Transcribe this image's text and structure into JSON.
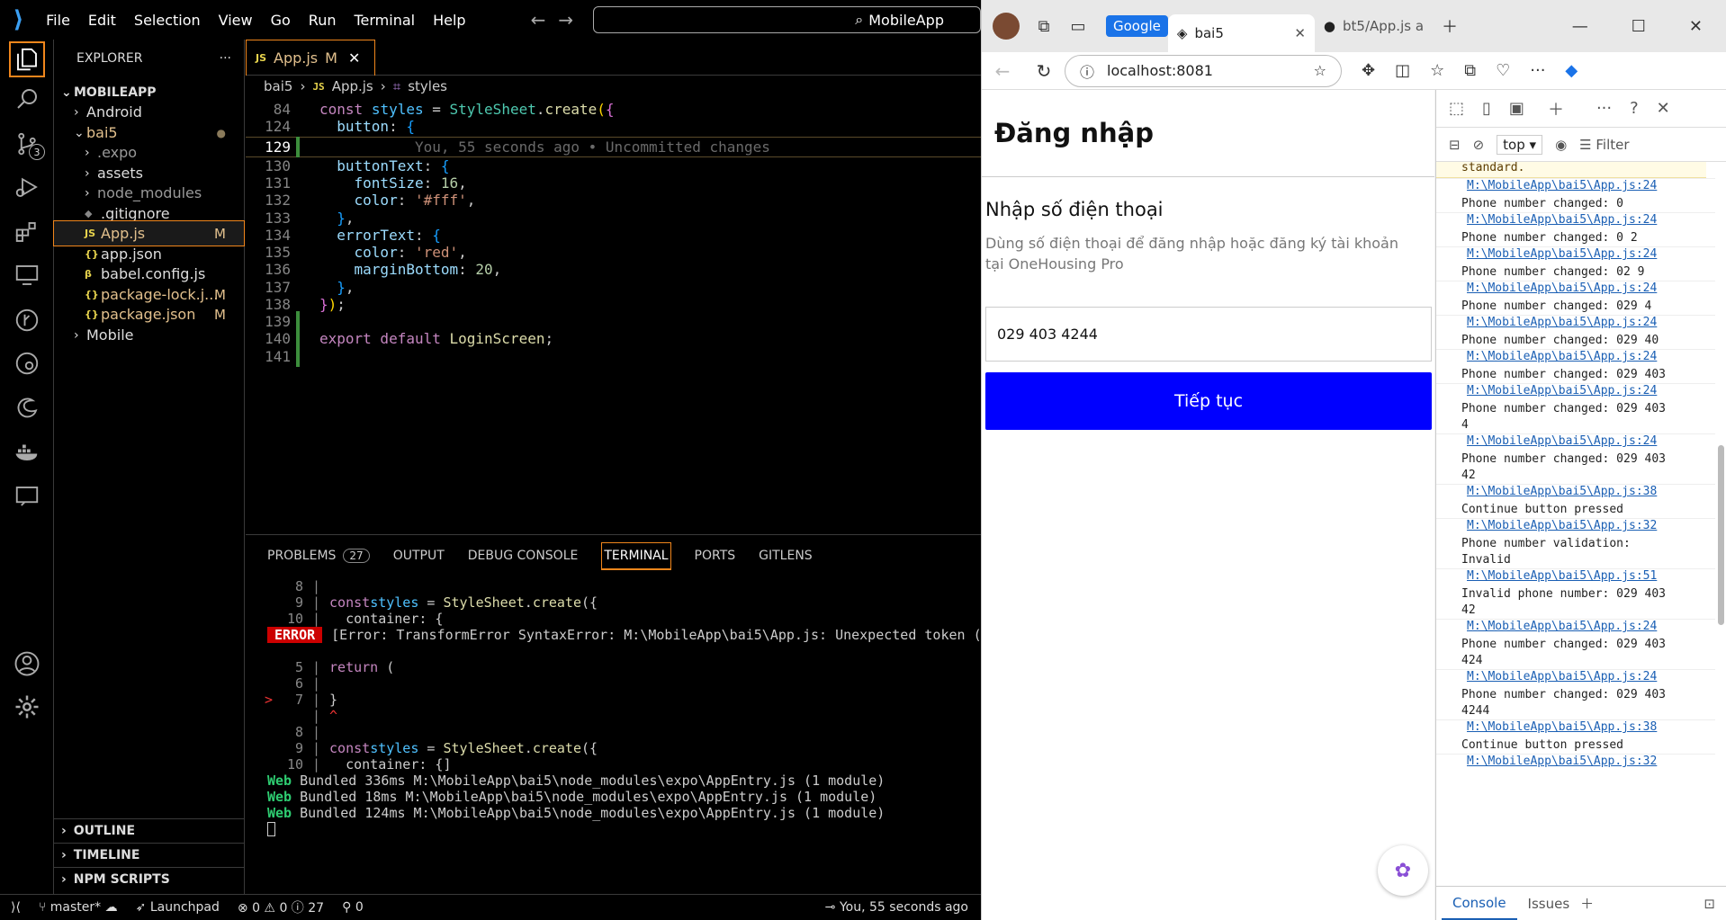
{
  "vscode": {
    "menu": [
      "File",
      "Edit",
      "Selection",
      "View",
      "Go",
      "Run",
      "Terminal",
      "Help"
    ],
    "command_center": "MobileApp",
    "explorer": {
      "title": "EXPLORER",
      "root": "MOBILEAPP",
      "items": [
        {
          "label": "Android",
          "type": "folder"
        },
        {
          "label": "bai5",
          "type": "folder-open"
        },
        {
          "label": ".expo",
          "type": "folder"
        },
        {
          "label": "assets",
          "type": "folder"
        },
        {
          "label": "node_modules",
          "type": "folder"
        },
        {
          "label": ".gitignore",
          "type": "file"
        },
        {
          "label": "App.js",
          "type": "js",
          "mod": "M"
        },
        {
          "label": "app.json",
          "type": "json"
        },
        {
          "label": "babel.config.js",
          "type": "babel"
        },
        {
          "label": "package-lock.j...",
          "type": "json",
          "mod": "M"
        },
        {
          "label": "package.json",
          "type": "json",
          "mod": "M"
        },
        {
          "label": "Mobile",
          "type": "folder"
        }
      ],
      "sections": [
        "OUTLINE",
        "TIMELINE",
        "NPM SCRIPTS"
      ]
    },
    "tab": {
      "label": "App.js",
      "mod": "M"
    },
    "breadcrumb": [
      "bai5",
      "App.js",
      "styles"
    ],
    "code": {
      "l84": "84",
      "l124": "124",
      "l129": "129",
      "l130": "130",
      "l131": "131",
      "l132": "132",
      "l133": "133",
      "l134": "134",
      "l135": "135",
      "l136": "136",
      "l137": "137",
      "l138": "138",
      "l139": "139",
      "l140": "140",
      "l141": "141",
      "blame": "You, 55 seconds ago • Uncommitted changes",
      "export_line": "export default LoginScreen;"
    },
    "panel": {
      "tabs": [
        "PROBLEMS",
        "OUTPUT",
        "DEBUG CONSOLE",
        "TERMINAL",
        "PORTS",
        "GITLENS"
      ],
      "problems_count": "27",
      "error_label": "ERROR",
      "error_text": "[Error: TransformError SyntaxError: M:\\MobileApp\\bai5\\App.js: Unexpected token (",
      "bundles": [
        {
          "tag": "Web",
          "text": " Bundled 336ms M:\\MobileApp\\bai5\\node_modules\\expo\\AppEntry.js (1 module)"
        },
        {
          "tag": "Web",
          "text": " Bundled 18ms M:\\MobileApp\\bai5\\node_modules\\expo\\AppEntry.js (1 module)"
        },
        {
          "tag": "Web",
          "text": " Bundled 124ms M:\\MobileApp\\bai5\\node_modules\\expo\\AppEntry.js (1 module)"
        }
      ]
    },
    "status": {
      "branch": "master*",
      "launchpad": "Launchpad",
      "errors": "0",
      "warnings": "0",
      "info": "27",
      "ports": "0",
      "blame": "You, 55 seconds ago"
    }
  },
  "browser": {
    "tabs": [
      {
        "label": "Google"
      },
      {
        "label": "bai5"
      },
      {
        "label": "bt5/App.js a"
      }
    ],
    "url": "localhost:8081",
    "app": {
      "title": "Đăng nhập",
      "subtitle": "Nhập số điện thoại",
      "description": "Dùng số điện thoại để đăng nhập hoặc đăng ký tài khoản tại OneHousing Pro",
      "phone_value": "029 403 4244",
      "button": "Tiếp tục"
    },
    "devtools": {
      "context": "top",
      "filter_placeholder": "Filter",
      "warn_tail": "standard.",
      "entries": [
        {
          "src": "M:\\MobileApp\\bai5\\App.js:24",
          "msg": "Phone number changed: 0"
        },
        {
          "src": "M:\\MobileApp\\bai5\\App.js:24",
          "msg": "Phone number changed: 0 2"
        },
        {
          "src": "M:\\MobileApp\\bai5\\App.js:24",
          "msg": "Phone number changed: 02 9"
        },
        {
          "src": "M:\\MobileApp\\bai5\\App.js:24",
          "msg": "Phone number changed: 029 4"
        },
        {
          "src": "M:\\MobileApp\\bai5\\App.js:24",
          "msg": "Phone number changed: 029 40"
        },
        {
          "src": "M:\\MobileApp\\bai5\\App.js:24",
          "msg": "Phone number changed: 029 403"
        },
        {
          "src": "M:\\MobileApp\\bai5\\App.js:24",
          "msg": "Phone number changed: 029 403\n4"
        },
        {
          "src": "M:\\MobileApp\\bai5\\App.js:24",
          "msg": "Phone number changed: 029 403\n42"
        },
        {
          "src": "M:\\MobileApp\\bai5\\App.js:38",
          "msg": "Continue button pressed"
        },
        {
          "src": "M:\\MobileApp\\bai5\\App.js:32",
          "msg": "Phone number validation:\nInvalid"
        },
        {
          "src": "M:\\MobileApp\\bai5\\App.js:51",
          "msg": "Invalid phone number: 029 403\n42"
        },
        {
          "src": "M:\\MobileApp\\bai5\\App.js:24",
          "msg": "Phone number changed: 029 403\n424"
        },
        {
          "src": "M:\\MobileApp\\bai5\\App.js:24",
          "msg": "Phone number changed: 029 403\n4244"
        },
        {
          "src": "M:\\MobileApp\\bai5\\App.js:38",
          "msg": "Continue button pressed"
        },
        {
          "src": "M:\\MobileApp\\bai5\\App.js:32",
          "msg": ""
        }
      ],
      "bottom_tabs": [
        "Console",
        "Issues"
      ]
    }
  }
}
